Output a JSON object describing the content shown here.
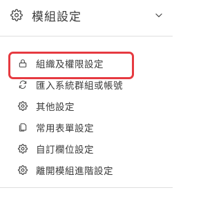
{
  "header": {
    "title": "模組設定",
    "icon": "gear-icon",
    "toggle_icon": "chevron-down-icon"
  },
  "menu": {
    "items": [
      {
        "label": "組織及權限設定",
        "icon": "lock-icon",
        "active": true
      },
      {
        "label": "匯入系統群組或帳號",
        "icon": "sync-icon",
        "active": false
      },
      {
        "label": "其他設定",
        "icon": "gear-icon",
        "active": false
      },
      {
        "label": "常用表單設定",
        "icon": "copy-icon",
        "active": false
      },
      {
        "label": "自訂欄位設定",
        "icon": "gear-icon",
        "active": false
      },
      {
        "label": "離開模組進階設定",
        "icon": "gear-icon",
        "active": false
      }
    ]
  },
  "colors": {
    "highlight_border": "#e63a40",
    "text": "#3a3a3a",
    "divider": "#dedede"
  }
}
